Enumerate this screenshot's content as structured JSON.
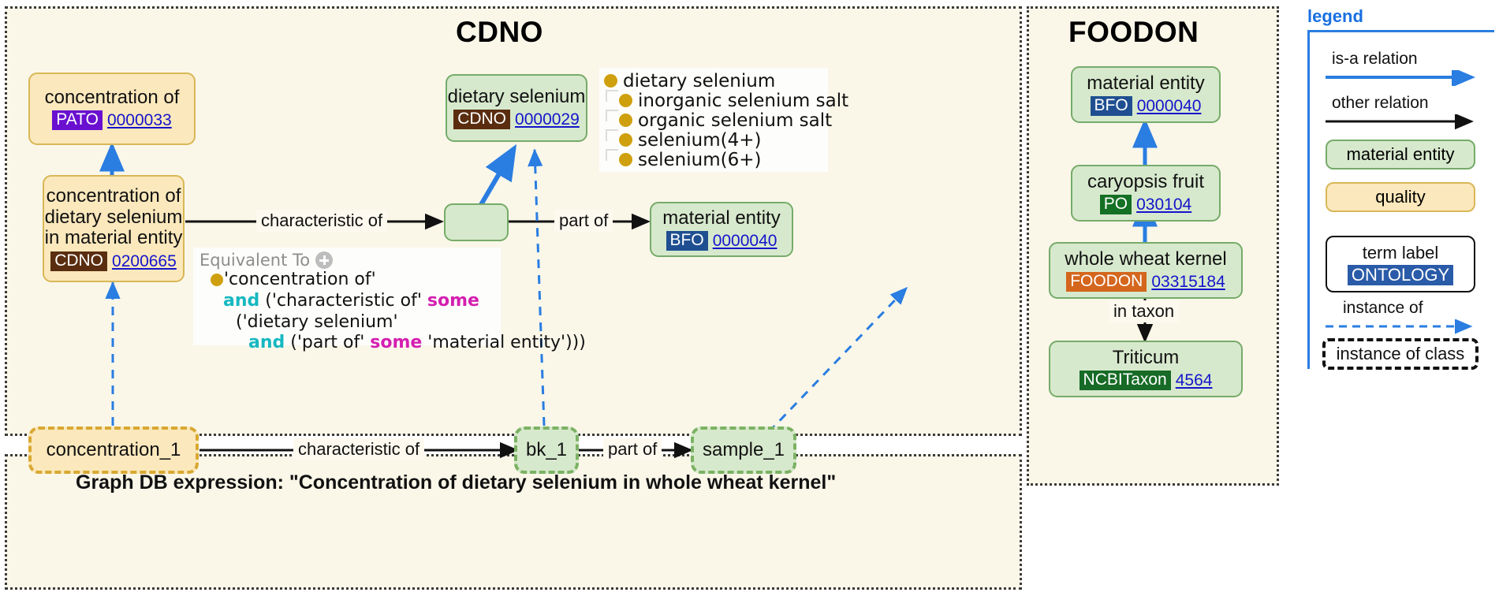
{
  "panels": {
    "cdno": {
      "title": "CDNO"
    },
    "foodon": {
      "title": "FOODON"
    },
    "graphdb": {
      "title": "Graph DB expression: \"Concentration of dietary selenium in whole wheat kernel\""
    }
  },
  "cdno_nodes": {
    "concentration_of": {
      "label": "concentration of",
      "ontology": "PATO",
      "id": "0000033"
    },
    "conc_of_ds_in_me": {
      "label_line1": "concentration of",
      "label_line2": "dietary selenium",
      "label_line3": "in material entity",
      "ontology": "CDNO",
      "id": "0200665"
    },
    "dietary_selenium": {
      "label": "dietary selenium",
      "ontology": "CDNO",
      "id": "0000029"
    },
    "anonymous": {
      "label": ""
    },
    "material_entity": {
      "label": "material entity",
      "ontology": "BFO",
      "id": "0000040"
    }
  },
  "cdno_edges": {
    "characteristic_of": "characteristic of",
    "part_of": "part of"
  },
  "taxonomy_popup": {
    "items": [
      {
        "label": "dietary selenium",
        "child": false
      },
      {
        "label": "inorganic selenium salt",
        "child": true
      },
      {
        "label": "organic selenium salt",
        "child": true
      },
      {
        "label": "selenium(4+)",
        "child": true
      },
      {
        "label": "selenium(6+)",
        "child": true
      }
    ]
  },
  "equivalent_popup": {
    "title": "Equivalent To",
    "lines": [
      {
        "indent": 0,
        "bullet": true,
        "parts": [
          {
            "t": "'concentration of'",
            "k": "plain"
          }
        ]
      },
      {
        "indent": 1,
        "bullet": false,
        "parts": [
          {
            "t": "and",
            "k": "and"
          },
          {
            "t": " ('characteristic of' ",
            "k": "plain"
          },
          {
            "t": "some",
            "k": "some"
          }
        ]
      },
      {
        "indent": 2,
        "bullet": false,
        "parts": [
          {
            "t": "('dietary selenium'",
            "k": "plain"
          }
        ]
      },
      {
        "indent": 3,
        "bullet": false,
        "parts": [
          {
            "t": "and",
            "k": "and"
          },
          {
            "t": " ('part of' ",
            "k": "plain"
          },
          {
            "t": "some",
            "k": "some"
          },
          {
            "t": " 'material entity')))",
            "k": "plain"
          }
        ]
      }
    ]
  },
  "foodon_nodes": {
    "material_entity": {
      "label": "material entity",
      "ontology": "BFO",
      "id": "0000040"
    },
    "caryopsis_fruit": {
      "label": "caryopsis fruit",
      "ontology": "PO",
      "id": "030104"
    },
    "whole_wheat_kernel": {
      "label": "whole wheat kernel",
      "ontology": "FOODON",
      "id": "03315184"
    },
    "triticum": {
      "label": "Triticum",
      "ontology": "NCBITaxon",
      "id": "4564"
    }
  },
  "foodon_edges": {
    "in_taxon": "in taxon"
  },
  "graphdb_nodes": {
    "concentration_1": {
      "label": "concentration_1"
    },
    "bk_1": {
      "label": "bk_1"
    },
    "sample_1": {
      "label": "sample_1"
    }
  },
  "graphdb_edges": {
    "characteristic_of": "characteristic of",
    "part_of": "part of"
  },
  "legend": {
    "title": "legend",
    "is_a_relation": "is-a relation",
    "other_relation": "other relation",
    "material_entity": "material entity",
    "quality": "quality",
    "term_label": "term label",
    "ontology": "ONTOLOGY",
    "instance_of": "instance of",
    "instance_of_class": "instance of class"
  },
  "colors": {
    "is_a_arrow": "#2a7de1",
    "other_arrow": "#111111",
    "instance_arrow": "#2a7de1",
    "material_fill": "#d7e9cd",
    "material_border": "#76ab69",
    "quality_fill": "#fbe8bc",
    "quality_border": "#d9b757",
    "panel_bg": "#faf7e9",
    "legend_accent": "#2a7de1",
    "bullet": "#cfa00d",
    "and_keyword": "#16b8c0",
    "some_keyword": "#d41fb0"
  }
}
